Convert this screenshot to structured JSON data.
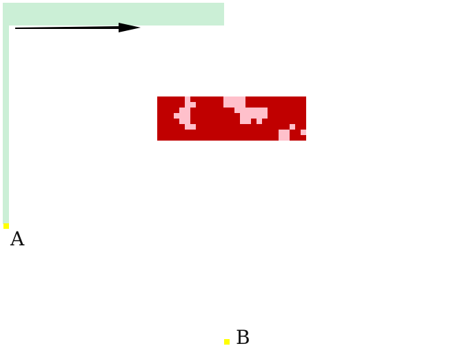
{
  "colors": {
    "grid_line": "#c8c8c8",
    "highlight_band": "#a0e1b4",
    "arrow": "#000000",
    "block_red": "#c00000",
    "block_pink": "#ffc0cb",
    "marker_yellow": "#ffff00"
  },
  "arrow": {
    "icon": "arrow-right-icon"
  },
  "red_block": {
    "cols": 27,
    "rows": 8,
    "pink_cells": [
      [
        5,
        0
      ],
      [
        5,
        1
      ],
      [
        6,
        1
      ],
      [
        4,
        2
      ],
      [
        5,
        2
      ],
      [
        3,
        3
      ],
      [
        4,
        3
      ],
      [
        5,
        3
      ],
      [
        4,
        4
      ],
      [
        5,
        4
      ],
      [
        5,
        5
      ],
      [
        6,
        5
      ],
      [
        12,
        0
      ],
      [
        13,
        0
      ],
      [
        14,
        0
      ],
      [
        15,
        0
      ],
      [
        12,
        1
      ],
      [
        13,
        1
      ],
      [
        14,
        1
      ],
      [
        15,
        1
      ],
      [
        14,
        2
      ],
      [
        15,
        2
      ],
      [
        16,
        2
      ],
      [
        17,
        2
      ],
      [
        18,
        2
      ],
      [
        19,
        2
      ],
      [
        15,
        3
      ],
      [
        16,
        3
      ],
      [
        17,
        3
      ],
      [
        18,
        3
      ],
      [
        19,
        3
      ],
      [
        15,
        4
      ],
      [
        16,
        4
      ],
      [
        18,
        4
      ],
      [
        24,
        5
      ],
      [
        22,
        6
      ],
      [
        23,
        6
      ],
      [
        26,
        6
      ],
      [
        22,
        7
      ],
      [
        23,
        7
      ]
    ]
  },
  "markers": [
    {
      "id": "A",
      "label": "A"
    },
    {
      "id": "B",
      "label": "B"
    }
  ]
}
